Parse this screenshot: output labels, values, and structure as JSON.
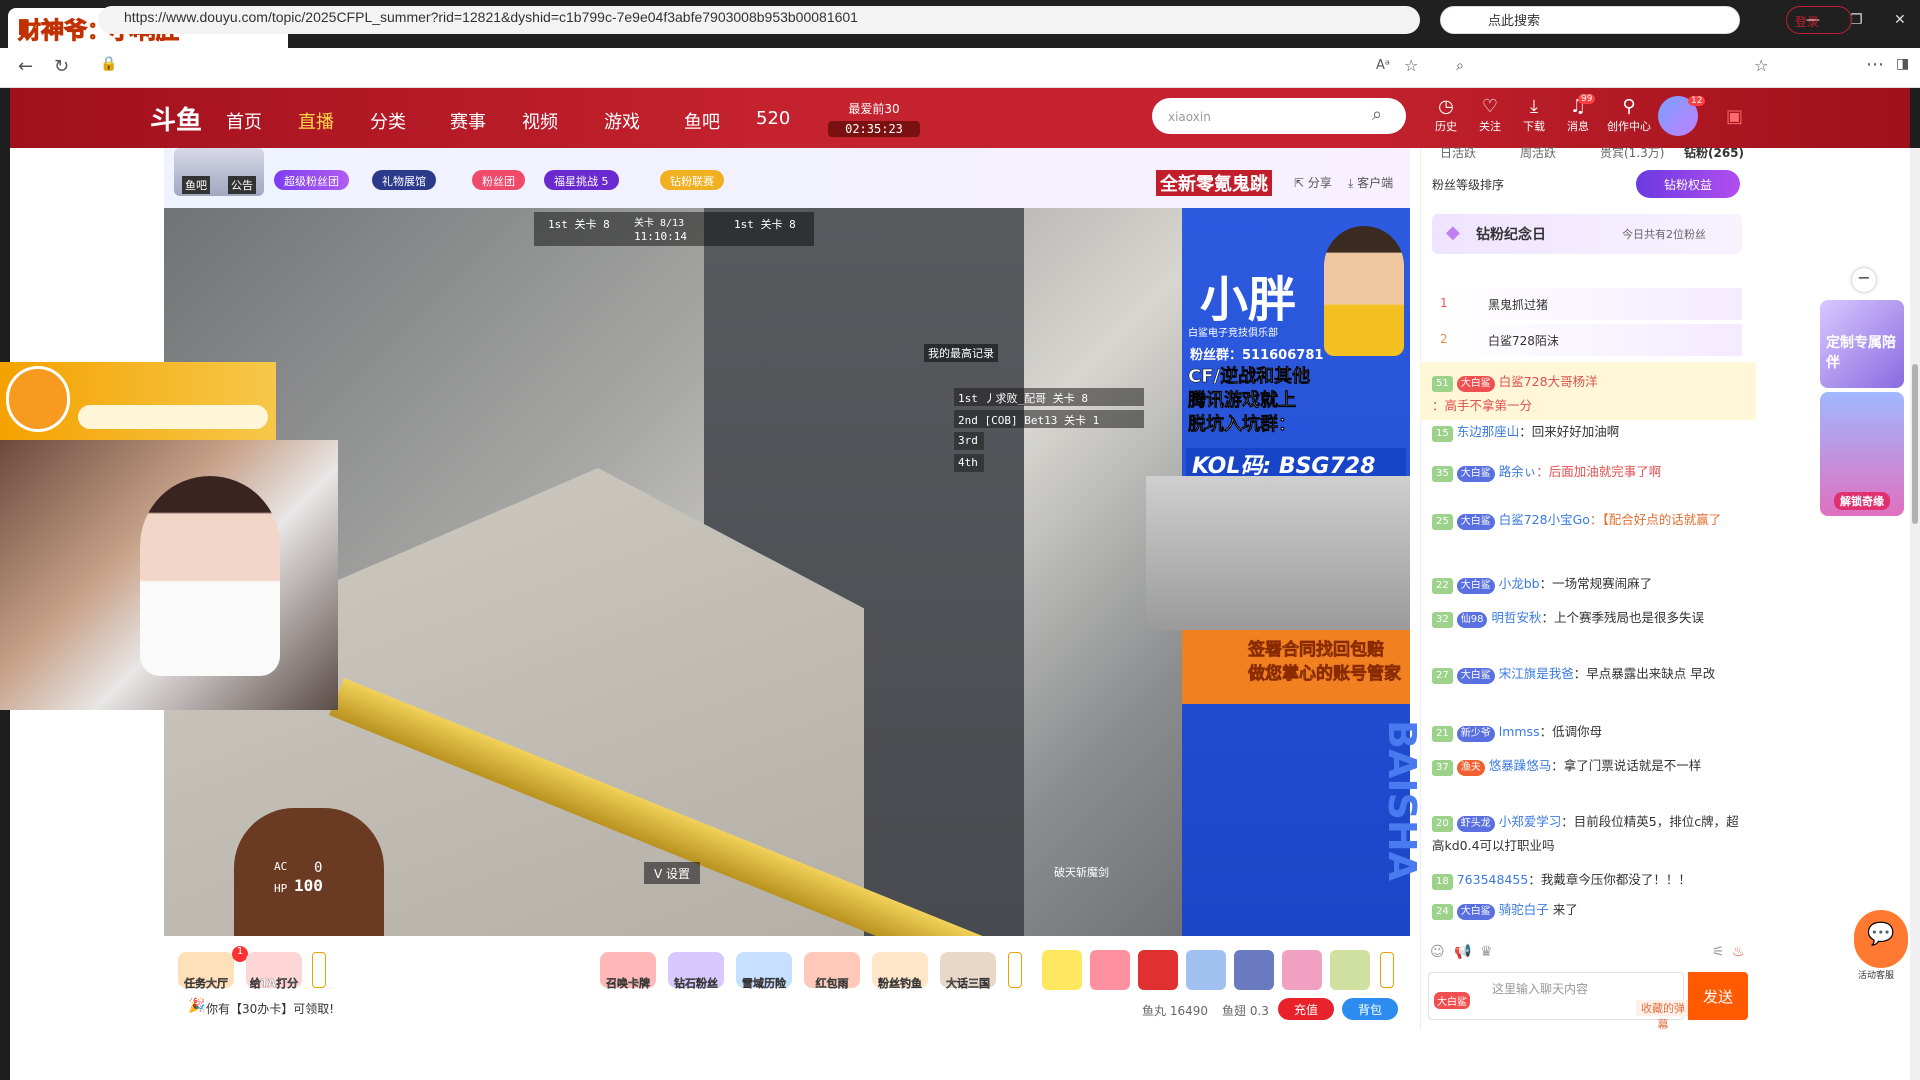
{
  "browser": {
    "tab_title": "财神爷：小啊胜",
    "url": "https://www.douyu.com/topic/2025CFPL_summer?rid=12821&dyshid=c1b799c-7e9e04f3abfe7903008b953b00081601",
    "search_placeholder": "点此搜索",
    "login_label": "登录"
  },
  "header": {
    "logo": "斗鱼",
    "nav": [
      "首页",
      "直播",
      "分类",
      "赛事",
      "视频",
      "游戏",
      "鱼吧",
      "520"
    ],
    "active_nav": "直播",
    "countdown_label": "最爱前30",
    "countdown_time": "02:35:23",
    "search_placeholder": "xiaoxin",
    "icons": [
      {
        "label": "历史",
        "icon": "history-icon"
      },
      {
        "label": "关注",
        "icon": "heart-icon"
      },
      {
        "label": "下载",
        "icon": "download-icon"
      },
      {
        "label": "消息",
        "icon": "bell-icon",
        "badge": "99"
      },
      {
        "label": "创作中心",
        "icon": "pin-icon"
      }
    ],
    "avatar_badge": "12"
  },
  "room": {
    "tags": [
      "超级粉丝团",
      "礼物展馆",
      "粉丝团",
      "福星挑战 5",
      "钻粉联赛"
    ],
    "fish_bar": "鱼吧",
    "announcement": "公告",
    "promo_title": "全新零氪鬼跳",
    "share": "分享",
    "client": "客户端"
  },
  "video": {
    "score_left": "1st 关卡 8",
    "score_mid_top": "关卡 8/13",
    "score_mid": "11:10:14",
    "score_right": "1st 关卡 8",
    "record_label": "我的最高记录",
    "ranks": [
      {
        "pos": "1st",
        "name": "丿求败_配哥",
        "stage": "关卡 8"
      },
      {
        "pos": "2nd",
        "name": "[COB] Bet13",
        "stage": "关卡 1"
      },
      {
        "pos": "3rd",
        "name": "",
        "stage": ""
      },
      {
        "pos": "4th",
        "name": "",
        "stage": ""
      }
    ],
    "hp_label": "HP",
    "hp_value": "100",
    "ac_label": "AC",
    "ac_value": "0",
    "weapon": "破天斩魔剑",
    "settings_label": "V 设置"
  },
  "overlay": {
    "name": "小胖",
    "club": "白鲨电子竞技俱乐部",
    "fans_group": "粉丝群：511606781",
    "line1": "CF/逆战和其他",
    "line2": "腾讯游戏就上",
    "line3": "脱坑入坑群：",
    "kol": "KOL码: BSG728",
    "promo": "签署合同找回包赔\n做您掌心的账号管家",
    "side": "BAISHA"
  },
  "toolbar": {
    "items": [
      "任务大厅",
      "给TA打分",
      "召唤卡牌",
      "钻石粉丝",
      "雪域历险",
      "红包雨",
      "粉丝钓鱼",
      "大话三国"
    ],
    "notice": "你有【30办卡】可领取!",
    "yuwan": "鱼丸 16490",
    "yuchi": "鱼翅 0.3",
    "recharge": "充值",
    "bag": "背包"
  },
  "panel": {
    "tabs": [
      "日活跃",
      "周活跃",
      "贵宾(1.3万)",
      "钻粉(265)"
    ],
    "sort_label": "粉丝等级排序",
    "vip_button": "钻粉权益",
    "anniv_title": "钻粉纪念日",
    "anniv_right": "今日共有2位粉丝",
    "rank": [
      {
        "no": "1",
        "name": "黑鬼抓过猪"
      },
      {
        "no": "2",
        "name": "白鲨728陌沫"
      }
    ],
    "messages": [
      {
        "lv": "51",
        "badge": "大白鲨",
        "name": "白鲨728大哥杨洋",
        "text": "：高手不拿第一分",
        "hl": true
      },
      {
        "lv": "15",
        "badge": "",
        "name": "东边那座山",
        "text": "：回来好好加油啊"
      },
      {
        "lv": "35",
        "badge": "大白鲨",
        "name": "路余ぃ",
        "text": "：后面加油就完事了啊"
      },
      {
        "lv": "25",
        "badge": "大白鲨",
        "name": "白鲨728小宝Go",
        "text": "：【配合好点的话就赢了"
      },
      {
        "lv": "22",
        "badge": "大白鲨",
        "name": "小龙bb",
        "text": "：一场常规赛闹麻了"
      },
      {
        "lv": "32",
        "badge": "仙98",
        "name": "明哲安秋",
        "text": "：上个赛季残局也是很多失误"
      },
      {
        "lv": "27",
        "badge": "大白鲨",
        "name": "宋江旗是我爸",
        "text": "：早点暴露出来缺点 早改"
      },
      {
        "lv": "21",
        "badge": "新少爷",
        "name": "lmmss",
        "text": "：低调你母"
      },
      {
        "lv": "37",
        "badge": "渔夫",
        "name": "悠暴躁悠马",
        "text": "：拿了门票说话就是不一样"
      },
      {
        "lv": "20",
        "badge": "虾头龙",
        "name": "小郑爱学习",
        "text": "：目前段位精英5，排位c牌，超高kd0.4可以打职业吗"
      },
      {
        "lv": "18",
        "badge": "",
        "name": "763548455",
        "text": "：我戴章今压你都没了！！！"
      },
      {
        "lv": "24",
        "badge": "大白鲨",
        "name": "骑驼白子",
        "text": " 来了"
      }
    ],
    "input_placeholder": "这里输入聊天内容",
    "danmu": "收藏的弹幕",
    "send": "发送",
    "input_badge": "大白鲨"
  },
  "side": {
    "promo1": "定制专属陪伴",
    "promo2": "解锁奇缘",
    "support": "活动客服"
  }
}
